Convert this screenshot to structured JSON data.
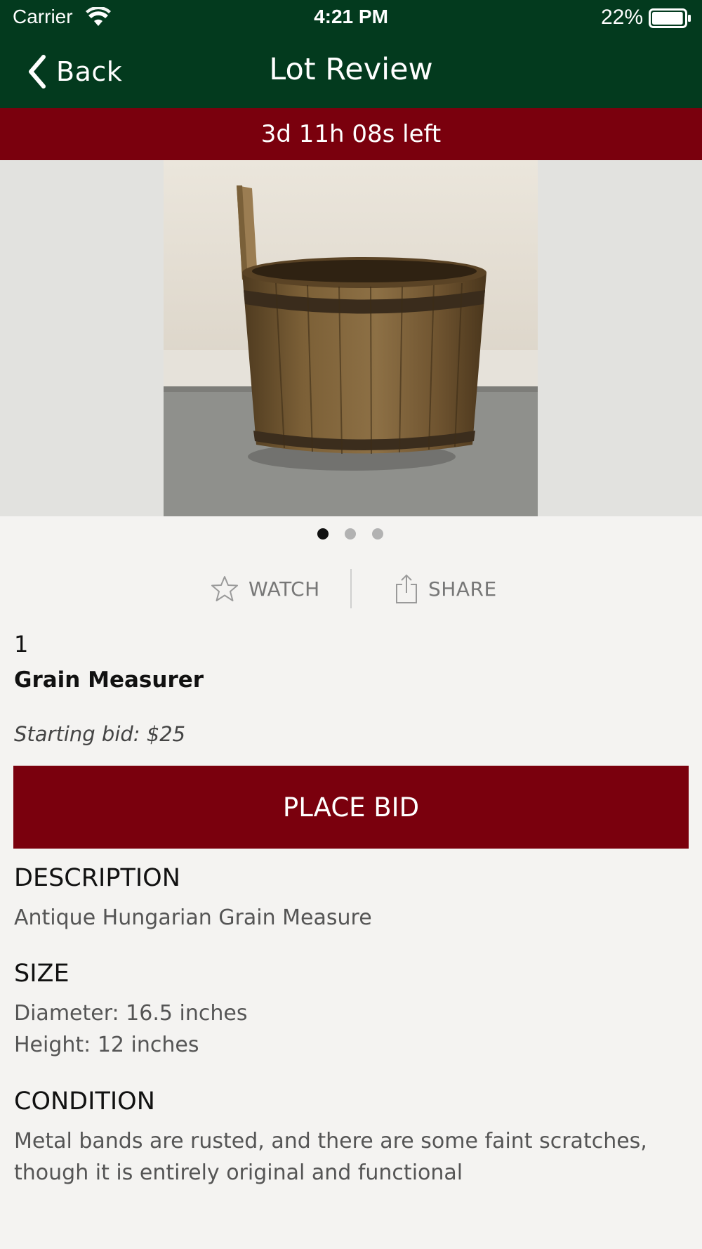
{
  "status_bar": {
    "carrier": "Carrier",
    "time": "4:21 PM",
    "battery_percent": "22%",
    "battery_level": 0.22
  },
  "nav": {
    "back_label": "Back",
    "title": "Lot Review"
  },
  "countdown": "3d 11h 08s left",
  "carousel": {
    "page_count": 3,
    "current_page": 1
  },
  "actions": {
    "watch_label": "WATCH",
    "share_label": "SHARE"
  },
  "lot": {
    "number": "1",
    "title": "Grain Measurer",
    "starting_bid": "Starting bid: $25",
    "place_bid_label": "PLACE BID"
  },
  "sections": {
    "description": {
      "heading": "DESCRIPTION",
      "lines": [
        "Antique Hungarian Grain Measure"
      ]
    },
    "size": {
      "heading": "SIZE",
      "lines": [
        "Diameter: 16.5 inches",
        "Height: 12 inches"
      ]
    },
    "condition": {
      "heading": "CONDITION",
      "lines": [
        "Metal bands are rusted, and there are some faint scratches,",
        "though it is entirely original and functional"
      ]
    }
  },
  "colors": {
    "header_green": "#033a1e",
    "accent_red": "#7a000d",
    "background": "#f4f3f1"
  }
}
